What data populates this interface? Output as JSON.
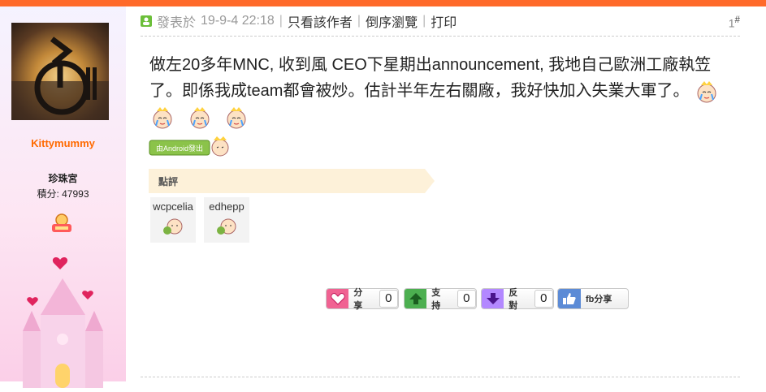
{
  "post": {
    "posted_label": "發表於",
    "posted_time": "19-9-4 22:18",
    "only_author": "只看該作者",
    "reverse": "倒序瀏覽",
    "print": "打印",
    "floor_number": "1",
    "floor_suffix": "#",
    "content": "做左20多年MNC, 收到風 CEO下星期出announcement, 我地自己歐洲工廠執笠了。即係我成team都會被炒。估計半年左右關廠，我好快加入失業大軍了。",
    "android_badge": "由Android發出"
  },
  "author": {
    "username": "Kittymummy",
    "group": "珍珠宮",
    "points": "積分: 47993"
  },
  "ratings": {
    "title": "點評",
    "users": [
      "wcpcelia",
      "edhepp"
    ]
  },
  "actions": {
    "share_label": "分享",
    "share_count": "0",
    "support_label": "支持",
    "support_count": "0",
    "oppose_label": "反對",
    "oppose_count": "0",
    "fb_label": "fb分享"
  },
  "colors": {
    "accent": "#ff6a2a",
    "username": "#ff6a00",
    "share": "#f06292",
    "support": "#4caf50",
    "oppose": "#b388ff",
    "fb": "#5c8bd6"
  }
}
